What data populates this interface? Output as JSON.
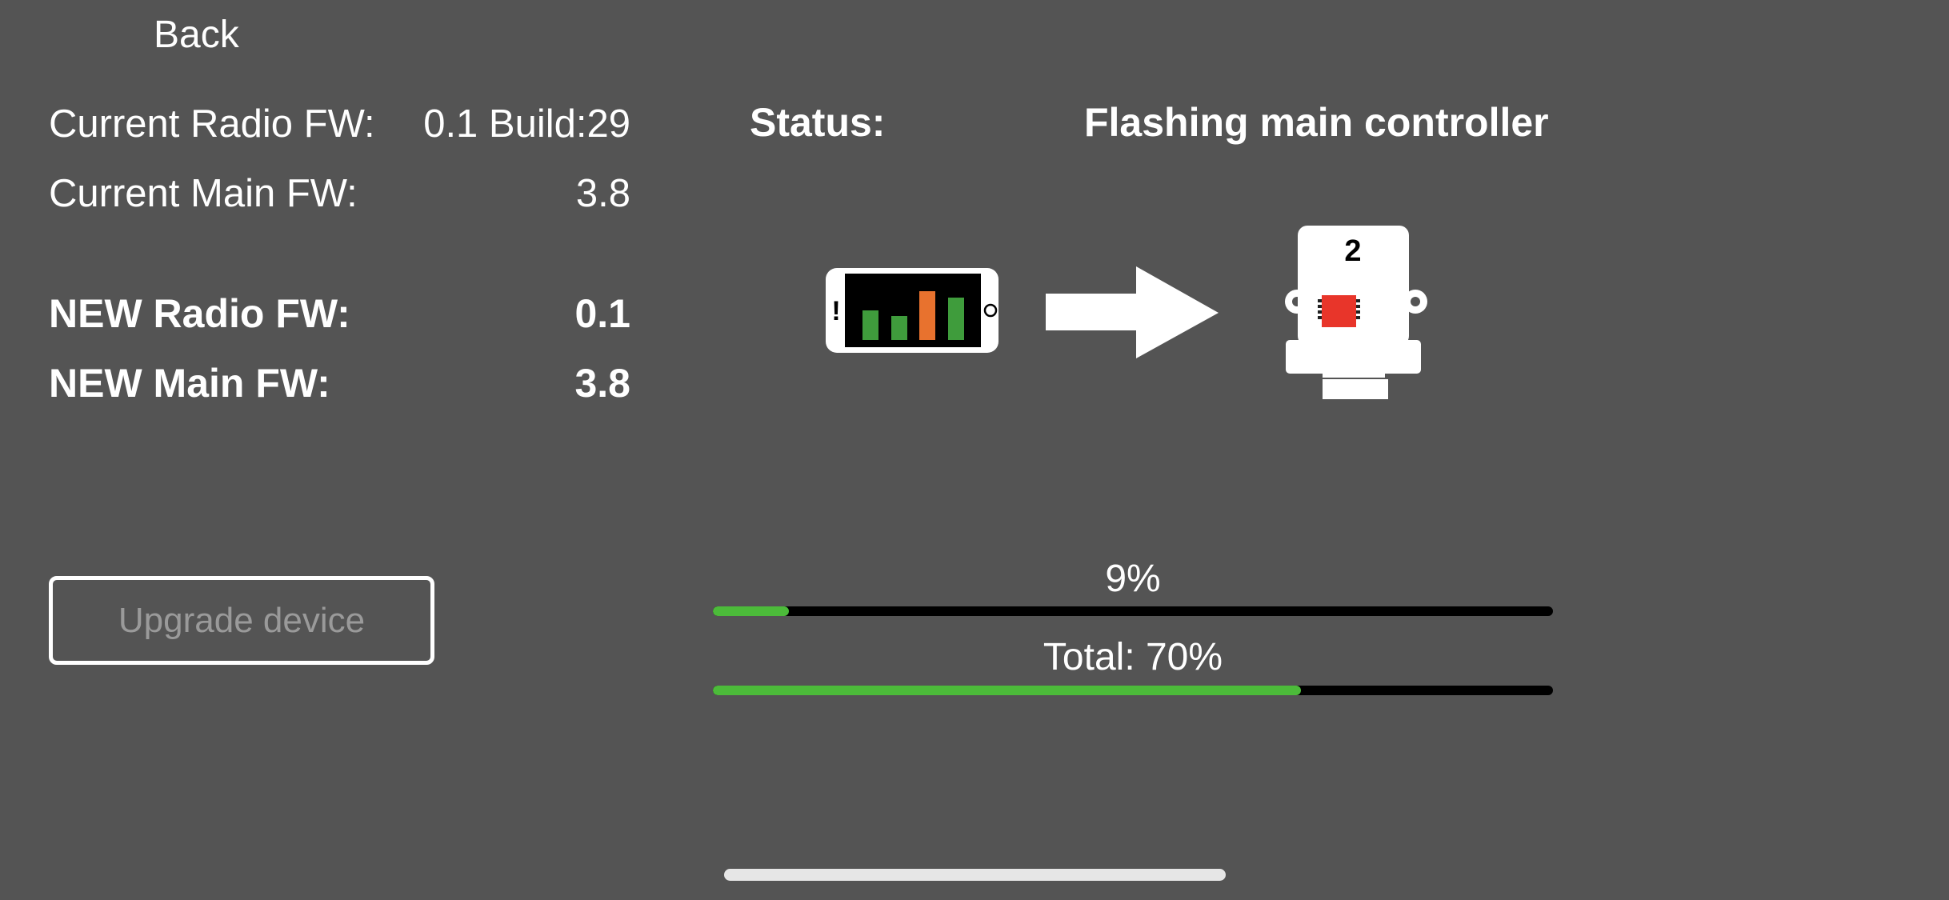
{
  "nav": {
    "back_label": "Back"
  },
  "firmware": {
    "current_radio": {
      "label": "Current Radio FW:",
      "value": "0.1 Build:29"
    },
    "current_main": {
      "label": "Current Main FW:",
      "value": "3.8"
    },
    "new_radio": {
      "label": "NEW Radio FW:",
      "value": "0.1"
    },
    "new_main": {
      "label": "NEW Main FW:",
      "value": "3.8"
    }
  },
  "actions": {
    "upgrade_label": "Upgrade device"
  },
  "status": {
    "label": "Status:",
    "value": "Flashing main controller"
  },
  "illustration": {
    "device_number": "2",
    "phone_alert": "!"
  },
  "progress": {
    "step": {
      "label": "9%",
      "fraction": 0.09
    },
    "total": {
      "label": "Total: 70%",
      "fraction": 0.7
    }
  },
  "colors": {
    "background": "#545454",
    "progress_fill": "#4cbb3a",
    "progress_track": "#000000",
    "chip": "#e8352a",
    "bar_green": "#3f9c3c",
    "bar_orange": "#e8722e",
    "disabled_text": "#9a9a9a"
  }
}
